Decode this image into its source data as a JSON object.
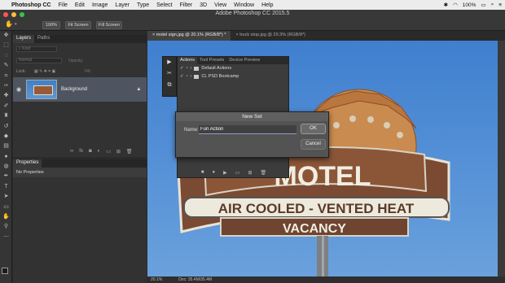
{
  "menubar": {
    "app": "Photoshop CC",
    "items": [
      "File",
      "Edit",
      "Image",
      "Layer",
      "Type",
      "Select",
      "Filter",
      "3D",
      "View",
      "Window",
      "Help"
    ],
    "right_text": "100%"
  },
  "window": {
    "title": "Adobe Photoshop CC 2015.5"
  },
  "options_bar": {
    "zoom": "100%",
    "fit_screen": "Fit Screen",
    "fill_screen": "Fill Screen"
  },
  "layers_panel": {
    "tabs": [
      "Layers",
      "Paths"
    ],
    "kind_placeholder": "Kind",
    "blend_mode": "Normal",
    "opacity_label": "Opacity:",
    "lock_label": "Lock:",
    "fill_label": "Fill:",
    "layer_name": "Background"
  },
  "properties_panel": {
    "title": "Properties",
    "subtitle": "No Properties"
  },
  "doc_tabs": [
    "motel sign.jpg @ 20.1% (RGB/8*) *",
    "truck stop.jpg @ 29.3% (RGB/8*)"
  ],
  "actions_panel": {
    "tabs": [
      "Actions",
      "Tool Presets",
      "Device Preview"
    ],
    "rows": [
      "Default Actions",
      "CL PSD Bootcamp"
    ]
  },
  "dialog": {
    "title": "New Set",
    "name_label": "Name:",
    "name_value": "Fun Action",
    "ok_label": "OK",
    "cancel_label": "Cancel"
  },
  "canvas": {
    "sign_line1": "AIR COOLED - VENTED HEAT",
    "sign_line2": "VACANCY",
    "sign_motel": "MOTEL"
  },
  "status": {
    "zoom": "20.1%",
    "doc": "Doc: 35.4M/35.4M"
  }
}
